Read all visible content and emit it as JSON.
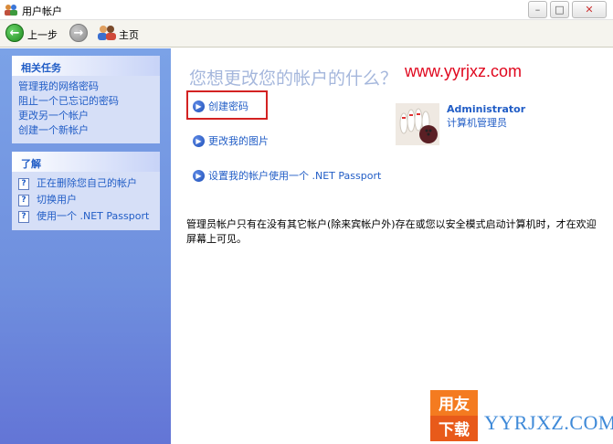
{
  "window": {
    "title": "用户帐户",
    "controls": {
      "minimize": "–",
      "maximize": "□",
      "close": "✕"
    }
  },
  "toolbar": {
    "back_label": "上一步",
    "home_label": "主页"
  },
  "sidebar": {
    "related_tasks": {
      "header": "相关任务",
      "items": [
        {
          "label": "管理我的网络密码"
        },
        {
          "label": "阻止一个已忘记的密码"
        },
        {
          "label": "更改另一个帐户"
        },
        {
          "label": "创建一个新帐户"
        }
      ]
    },
    "learn": {
      "header": "了解",
      "help_icon": "?",
      "items": [
        {
          "label": "正在删除您自己的帐户"
        },
        {
          "label": "切换用户"
        },
        {
          "label": "使用一个 .NET Passport"
        }
      ]
    }
  },
  "main": {
    "title": "您想更改您的帐户的什么？",
    "watermark": "www.yyrjxz.com",
    "actions": [
      {
        "label": "创建密码"
      },
      {
        "label": "更改我的图片"
      },
      {
        "label": "设置我的帐户使用一个 .NET Passport"
      }
    ],
    "account": {
      "name": "Administrator",
      "role": "计算机管理员"
    },
    "note": "管理员帐户只有在没有其它帐户(除来宾帐户外)存在或您以安全模式启动计算机时，才在欢迎屏幕上可见。"
  },
  "brand": {
    "logo_top": "用友",
    "logo_bottom": "下载",
    "site": "YYRJXZ.COM"
  },
  "colors": {
    "link": "#215dc6",
    "sidebar": "#7ba2e7",
    "highlight": "#d32222",
    "watermark": "#e0071e"
  }
}
